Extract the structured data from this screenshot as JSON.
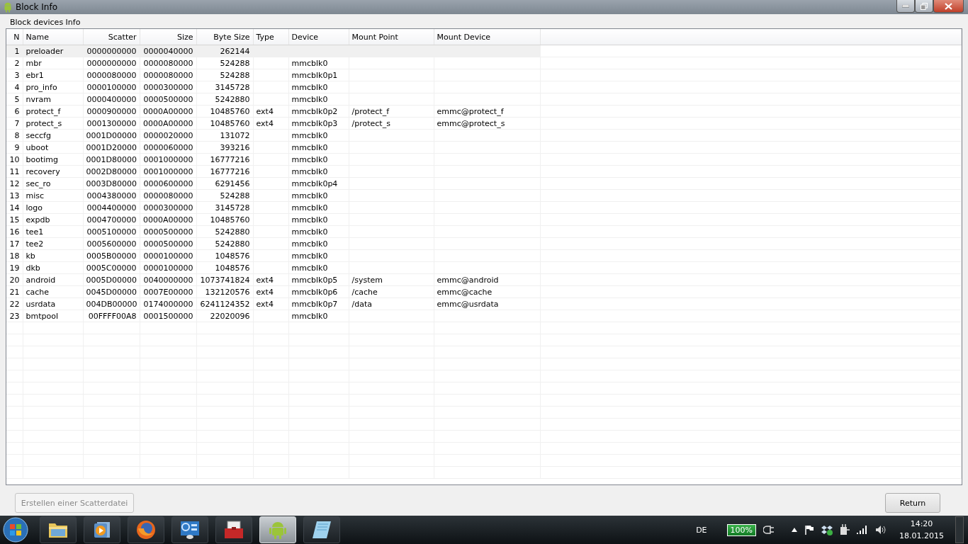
{
  "window": {
    "title": "Block Info"
  },
  "group": {
    "title": "Block devices Info"
  },
  "table": {
    "columns": [
      "N",
      "Name",
      "Scatter",
      "Size",
      "Byte Size",
      "Type",
      "Device",
      "Mount Point",
      "Mount Device"
    ],
    "rows": [
      {
        "selected": true,
        "cells": [
          "1",
          "preloader",
          "0000000000",
          "0000040000",
          "262144",
          "",
          "",
          "",
          ""
        ]
      },
      {
        "selected": false,
        "cells": [
          "2",
          "mbr",
          "0000000000",
          "0000080000",
          "524288",
          "",
          "mmcblk0",
          "",
          ""
        ]
      },
      {
        "selected": false,
        "cells": [
          "3",
          "ebr1",
          "0000080000",
          "0000080000",
          "524288",
          "",
          "mmcblk0p1",
          "",
          ""
        ]
      },
      {
        "selected": false,
        "cells": [
          "4",
          "pro_info",
          "0000100000",
          "0000300000",
          "3145728",
          "",
          "mmcblk0",
          "",
          ""
        ]
      },
      {
        "selected": false,
        "cells": [
          "5",
          "nvram",
          "0000400000",
          "0000500000",
          "5242880",
          "",
          "mmcblk0",
          "",
          ""
        ]
      },
      {
        "selected": false,
        "cells": [
          "6",
          "protect_f",
          "0000900000",
          "0000A00000",
          "10485760",
          "ext4",
          "mmcblk0p2",
          "/protect_f",
          "emmc@protect_f"
        ]
      },
      {
        "selected": false,
        "cells": [
          "7",
          "protect_s",
          "0001300000",
          "0000A00000",
          "10485760",
          "ext4",
          "mmcblk0p3",
          "/protect_s",
          "emmc@protect_s"
        ]
      },
      {
        "selected": false,
        "cells": [
          "8",
          "seccfg",
          "0001D00000",
          "0000020000",
          "131072",
          "",
          "mmcblk0",
          "",
          ""
        ]
      },
      {
        "selected": false,
        "cells": [
          "9",
          "uboot",
          "0001D20000",
          "0000060000",
          "393216",
          "",
          "mmcblk0",
          "",
          ""
        ]
      },
      {
        "selected": false,
        "cells": [
          "10",
          "bootimg",
          "0001D80000",
          "0001000000",
          "16777216",
          "",
          "mmcblk0",
          "",
          ""
        ]
      },
      {
        "selected": false,
        "cells": [
          "11",
          "recovery",
          "0002D80000",
          "0001000000",
          "16777216",
          "",
          "mmcblk0",
          "",
          ""
        ]
      },
      {
        "selected": false,
        "cells": [
          "12",
          "sec_ro",
          "0003D80000",
          "0000600000",
          "6291456",
          "",
          "mmcblk0p4",
          "",
          ""
        ]
      },
      {
        "selected": false,
        "cells": [
          "13",
          "misc",
          "0004380000",
          "0000080000",
          "524288",
          "",
          "mmcblk0",
          "",
          ""
        ]
      },
      {
        "selected": false,
        "cells": [
          "14",
          "logo",
          "0004400000",
          "0000300000",
          "3145728",
          "",
          "mmcblk0",
          "",
          ""
        ]
      },
      {
        "selected": false,
        "cells": [
          "15",
          "expdb",
          "0004700000",
          "0000A00000",
          "10485760",
          "",
          "mmcblk0",
          "",
          ""
        ]
      },
      {
        "selected": false,
        "cells": [
          "16",
          "tee1",
          "0005100000",
          "0000500000",
          "5242880",
          "",
          "mmcblk0",
          "",
          ""
        ]
      },
      {
        "selected": false,
        "cells": [
          "17",
          "tee2",
          "0005600000",
          "0000500000",
          "5242880",
          "",
          "mmcblk0",
          "",
          ""
        ]
      },
      {
        "selected": false,
        "cells": [
          "18",
          "kb",
          "0005B00000",
          "0000100000",
          "1048576",
          "",
          "mmcblk0",
          "",
          ""
        ]
      },
      {
        "selected": false,
        "cells": [
          "19",
          "dkb",
          "0005C00000",
          "0000100000",
          "1048576",
          "",
          "mmcblk0",
          "",
          ""
        ]
      },
      {
        "selected": false,
        "cells": [
          "20",
          "android",
          "0005D00000",
          "0040000000",
          "1073741824",
          "ext4",
          "mmcblk0p5",
          "/system",
          "emmc@android"
        ]
      },
      {
        "selected": false,
        "cells": [
          "21",
          "cache",
          "0045D00000",
          "0007E00000",
          "132120576",
          "ext4",
          "mmcblk0p6",
          "/cache",
          "emmc@cache"
        ]
      },
      {
        "selected": false,
        "cells": [
          "22",
          "usrdata",
          "004DB00000",
          "0174000000",
          "6241124352",
          "ext4",
          "mmcblk0p7",
          "/data",
          "emmc@usrdata"
        ]
      },
      {
        "selected": false,
        "cells": [
          "23",
          "bmtpool",
          "00FFFF00A8",
          "0001500000",
          "22020096",
          "",
          "mmcblk0",
          "",
          ""
        ]
      }
    ]
  },
  "buttons": [
    {
      "label": "Erstellen einer Scatterdatei",
      "disabled": true
    },
    {
      "label": "Return",
      "disabled": false
    }
  ],
  "taskbar": {
    "apps": [
      {
        "kind": "folder",
        "selected": false
      },
      {
        "kind": "media",
        "selected": false
      },
      {
        "kind": "browser",
        "selected": false
      },
      {
        "kind": "panel",
        "selected": false
      },
      {
        "kind": "toolbox",
        "selected": false
      },
      {
        "kind": "android",
        "selected": true
      },
      {
        "kind": "notepad",
        "selected": false
      }
    ],
    "language": "DE",
    "battery": "100%",
    "time": "14:20",
    "date": "18.01.2015"
  }
}
